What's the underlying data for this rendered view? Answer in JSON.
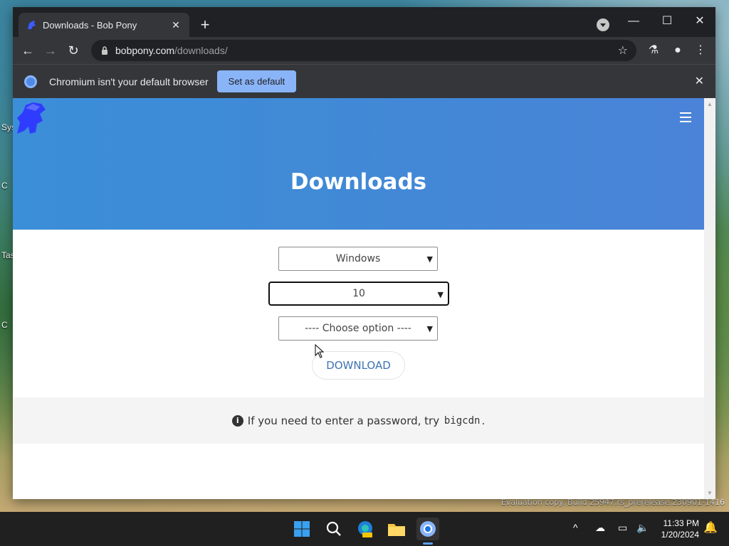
{
  "browser": {
    "tab_title": "Downloads - Bob Pony",
    "url_host": "bobpony.com",
    "url_path": "/downloads/",
    "infobar_text": "Chromium isn't your default browser",
    "infobar_button": "Set as default"
  },
  "page": {
    "heading": "Downloads",
    "select_os": "Windows",
    "select_version": "10",
    "select_option": "---- Choose option ----",
    "download_button": "DOWNLOAD",
    "note_prefix": "If you need to enter a password, try",
    "note_code": "bigcdn",
    "note_suffix": "."
  },
  "desktop": {
    "watermark": "Evaluation copy. Build 25947.rs_prerelease.230901-1416"
  },
  "taskbar": {
    "time": "11:33 PM",
    "date": "1/20/2024"
  },
  "colors": {
    "hero_blue": "#4189d6",
    "accent": "#8ab4f8",
    "link_blue": "#3f74b4"
  }
}
